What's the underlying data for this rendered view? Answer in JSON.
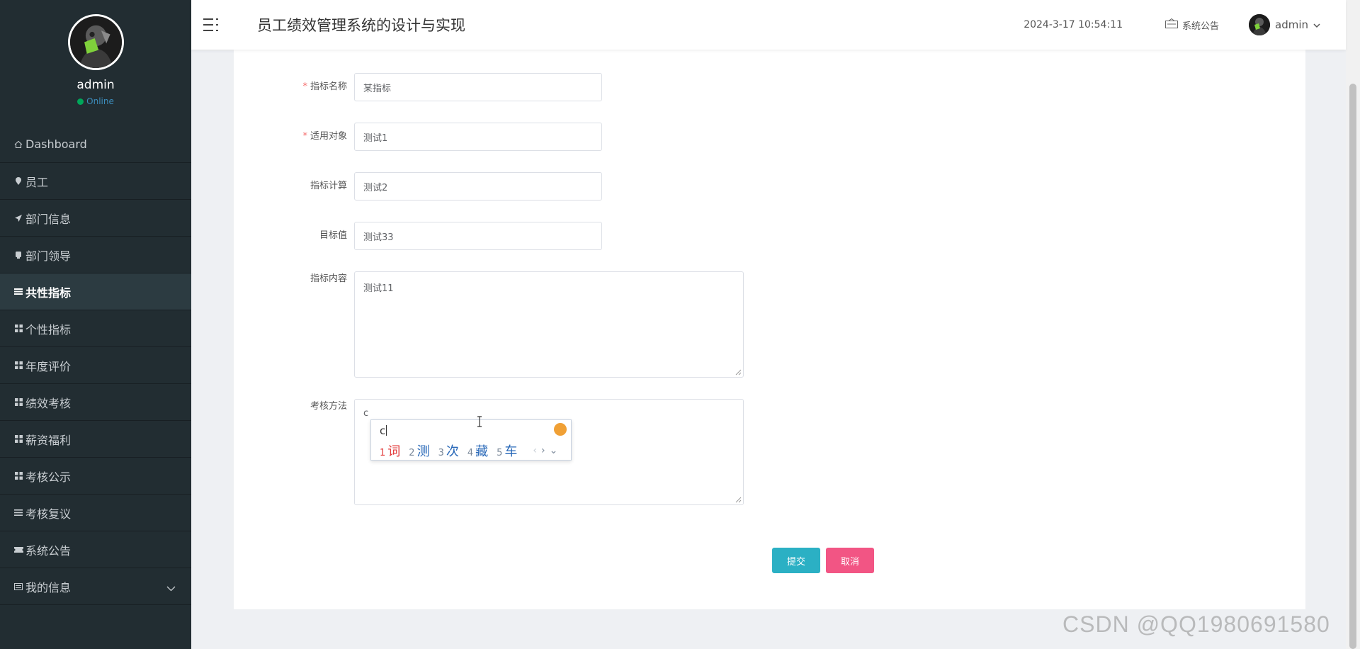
{
  "sidebar": {
    "profile": {
      "name": "admin",
      "status": "Online"
    },
    "items": [
      {
        "label": "Dashboard",
        "icon": "home-icon"
      },
      {
        "label": "员工",
        "icon": "map-pin-icon"
      },
      {
        "label": "部门信息",
        "icon": "paper-plane-icon"
      },
      {
        "label": "部门领导",
        "icon": "mug-icon"
      },
      {
        "label": "共性指标",
        "icon": "list-icon",
        "active": true
      },
      {
        "label": "个性指标",
        "icon": "grid-icon"
      },
      {
        "label": "年度评价",
        "icon": "grid-icon"
      },
      {
        "label": "绩效考核",
        "icon": "grid-icon"
      },
      {
        "label": "薪资福利",
        "icon": "grid-icon"
      },
      {
        "label": "考核公示",
        "icon": "grid-icon"
      },
      {
        "label": "考核复议",
        "icon": "list-icon"
      },
      {
        "label": "系统公告",
        "icon": "ticket-icon"
      },
      {
        "label": "我的信息",
        "icon": "id-card-icon",
        "expandable": true
      }
    ]
  },
  "header": {
    "title": "员工绩效管理系统的设计与实现",
    "datetime": "2024-3-17 10:54:11",
    "notice_label": "系统公告",
    "user_name": "admin"
  },
  "form": {
    "fields": [
      {
        "label": "指标名称",
        "value": "某指标",
        "required": true
      },
      {
        "label": "适用对象",
        "value": "测试1",
        "required": true
      },
      {
        "label": "指标计算",
        "value": "测试2",
        "required": false
      },
      {
        "label": "目标值",
        "value": "测试33",
        "required": false
      }
    ],
    "content": {
      "label": "指标内容",
      "value": "测试11"
    },
    "method": {
      "label": "考核方法",
      "value": "c"
    },
    "submit_label": "提交",
    "cancel_label": "取消"
  },
  "ime": {
    "input": "c",
    "candidates": [
      {
        "num": "1",
        "text": "词"
      },
      {
        "num": "2",
        "text": "测"
      },
      {
        "num": "3",
        "text": "次"
      },
      {
        "num": "4",
        "text": "藏"
      },
      {
        "num": "5",
        "text": "车"
      }
    ],
    "prev": "‹",
    "next": "›",
    "expand": "⌄"
  },
  "watermark": "CSDN @QQ1980691580",
  "colors": {
    "sidebar_bg": "#222d32",
    "submit": "#2bb0c4",
    "cancel": "#f25584",
    "required": "#f56c6c"
  }
}
